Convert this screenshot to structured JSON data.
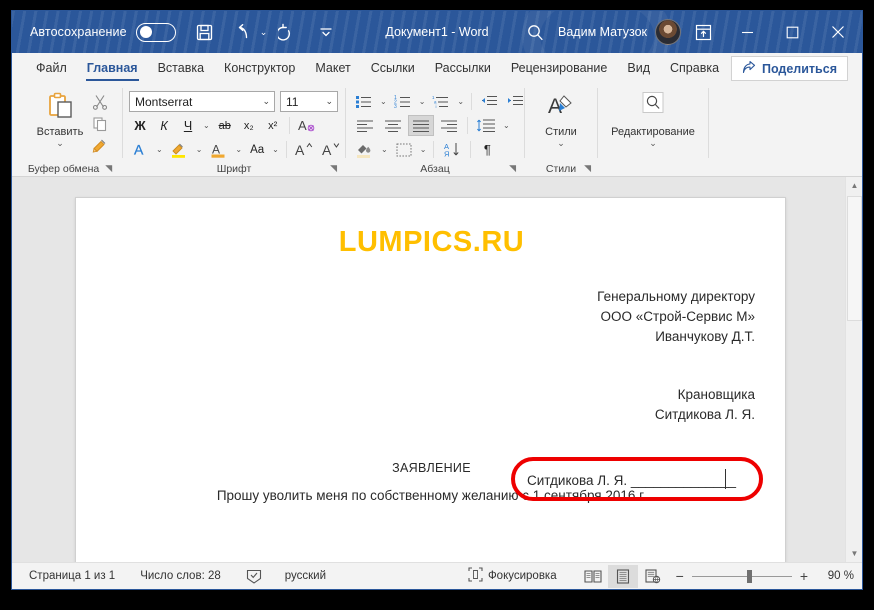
{
  "titlebar": {
    "autosave_label": "Автосохранение",
    "autosave_state": "off",
    "save_icon": "save-icon",
    "undo_icon": "undo-icon",
    "redo_icon": "redo-icon",
    "qat_more_icon": "quick-access-more-icon",
    "document_title": "Документ1  -  Word",
    "search_icon": "search-icon",
    "user_name": "Вадим Матузок",
    "avatar": "user-avatar",
    "ribbon_display_icon": "ribbon-display-options-icon",
    "minimize_label": "—",
    "maximize_label": "□",
    "close_label": "✕"
  },
  "tabs": {
    "items": [
      {
        "label": "Файл",
        "active": false
      },
      {
        "label": "Главная",
        "active": true
      },
      {
        "label": "Вставка",
        "active": false
      },
      {
        "label": "Конструктор",
        "active": false
      },
      {
        "label": "Макет",
        "active": false
      },
      {
        "label": "Ссылки",
        "active": false
      },
      {
        "label": "Рассылки",
        "active": false
      },
      {
        "label": "Рецензирование",
        "active": false
      },
      {
        "label": "Вид",
        "active": false
      },
      {
        "label": "Справка",
        "active": false
      }
    ],
    "share_label": "Поделиться",
    "share_icon": "share-icon"
  },
  "ribbon": {
    "clipboard": {
      "group_label": "Буфер обмена",
      "paste_label": "Вставить",
      "paste_icon": "paste-icon",
      "cut_icon": "cut-icon",
      "copy_icon": "copy-icon",
      "format_painter_icon": "format-painter-icon",
      "dialog_launcher": "dialog-launcher-icon"
    },
    "font": {
      "group_label": "Шрифт",
      "font_name": "Montserrat",
      "font_size": "11",
      "bold_label": "Ж",
      "italic_label": "К",
      "underline_label": "Ч",
      "strikethrough_label": "аb",
      "subscript_label": "x₂",
      "superscript_label": "x²",
      "clear_format_icon": "clear-formatting-icon",
      "text_effects_icon": "text-effects-icon",
      "highlight_icon": "text-highlight-icon",
      "font_color_icon": "font-color-icon",
      "change_case_label": "Aa",
      "grow_font_label": "A",
      "shrink_font_label": "A",
      "dialog_launcher": "dialog-launcher-icon"
    },
    "paragraph": {
      "group_label": "Абзац",
      "bullets_icon": "bullet-list-icon",
      "numbering_icon": "numbered-list-icon",
      "multilevel_icon": "multilevel-list-icon",
      "decrease_indent_icon": "decrease-indent-icon",
      "increase_indent_icon": "increase-indent-icon",
      "align_left_icon": "align-left-icon",
      "align_center_icon": "align-center-icon",
      "align_justify_icon": "align-justify-icon",
      "align_right_icon": "align-right-icon",
      "line_spacing_icon": "line-spacing-icon",
      "shading_icon": "shading-icon",
      "borders_icon": "borders-icon",
      "sort_icon": "sort-icon",
      "show_marks_label": "¶",
      "dialog_launcher": "dialog-launcher-icon"
    },
    "styles": {
      "group_label": "Стили",
      "button_label": "Стили",
      "icon": "styles-icon",
      "dialog_launcher": "dialog-launcher-icon"
    },
    "editing": {
      "button_label": "Редактирование",
      "icon": "editing-search-icon"
    },
    "collapse_ribbon_icon": "collapse-ribbon-icon"
  },
  "document": {
    "watermark": "LUMPICS.RU",
    "addressee": [
      "Генеральному директору",
      "ООО «Строй-Сервис М»",
      "Иванчукову Д.Т."
    ],
    "author": [
      "Крановщика",
      "Ситдикова Л. Я."
    ],
    "heading": "ЗАЯВЛЕНИЕ",
    "body": "Прошу уволить меня по собственному желанию с 1 сентября 2016 г.",
    "signature_line": "Ситдикова Л. Я. ______________",
    "highlight_color": "#ee0000",
    "watermark_color": "#ffbf00"
  },
  "statusbar": {
    "page_label": "Страница 1 из 1",
    "words_label": "Число слов: 28",
    "proofing_icon": "proofing-icon",
    "language_label": "русский",
    "focus_icon": "focus-mode-icon",
    "focus_label": "Фокусировка",
    "read_mode_icon": "read-mode-icon",
    "print_layout_icon": "print-layout-icon",
    "web_layout_icon": "web-layout-icon",
    "zoom_out_label": "−",
    "zoom_in_label": "+",
    "zoom_level": "90 %"
  },
  "scrollbar": {
    "up_arrow": "▲",
    "down_arrow": "▼"
  }
}
